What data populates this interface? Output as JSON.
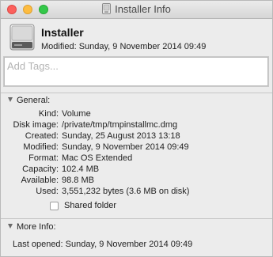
{
  "window": {
    "title": "Installer Info"
  },
  "header": {
    "name": "Installer",
    "modified": "Modified: Sunday, 9 November 2014 09:49"
  },
  "tags": {
    "placeholder": "Add Tags..."
  },
  "general": {
    "heading": "General:",
    "rows": [
      {
        "label": "Kind:",
        "value": "Volume"
      },
      {
        "label": "Disk image:",
        "value": "/private/tmp/tmpinstallmc.dmg"
      },
      {
        "label": "Created:",
        "value": "Sunday, 25 August 2013 13:18"
      },
      {
        "label": "Modified:",
        "value": "Sunday, 9 November 2014 09:49"
      },
      {
        "label": "Format:",
        "value": "Mac OS Extended"
      },
      {
        "label": "Capacity:",
        "value": "102.4 MB"
      },
      {
        "label": "Available:",
        "value": "98.8 MB"
      },
      {
        "label": "Used:",
        "value": "3,551,232 bytes (3.6 MB on disk)"
      }
    ],
    "shared_folder_label": "Shared folder",
    "shared_folder_checked": false
  },
  "more_info": {
    "heading": "More Info:",
    "last_opened": "Last opened: Sunday, 9 November 2014 09:49"
  },
  "icons": {
    "window_icon": "disk-icon",
    "header_icon": "external-drive-icon",
    "disclosure": "disclosure-triangle-icon"
  },
  "colors": {
    "close": "#fc605c",
    "minimize": "#fdbc40",
    "maximize": "#34c84a",
    "window_bg": "#ececec"
  }
}
